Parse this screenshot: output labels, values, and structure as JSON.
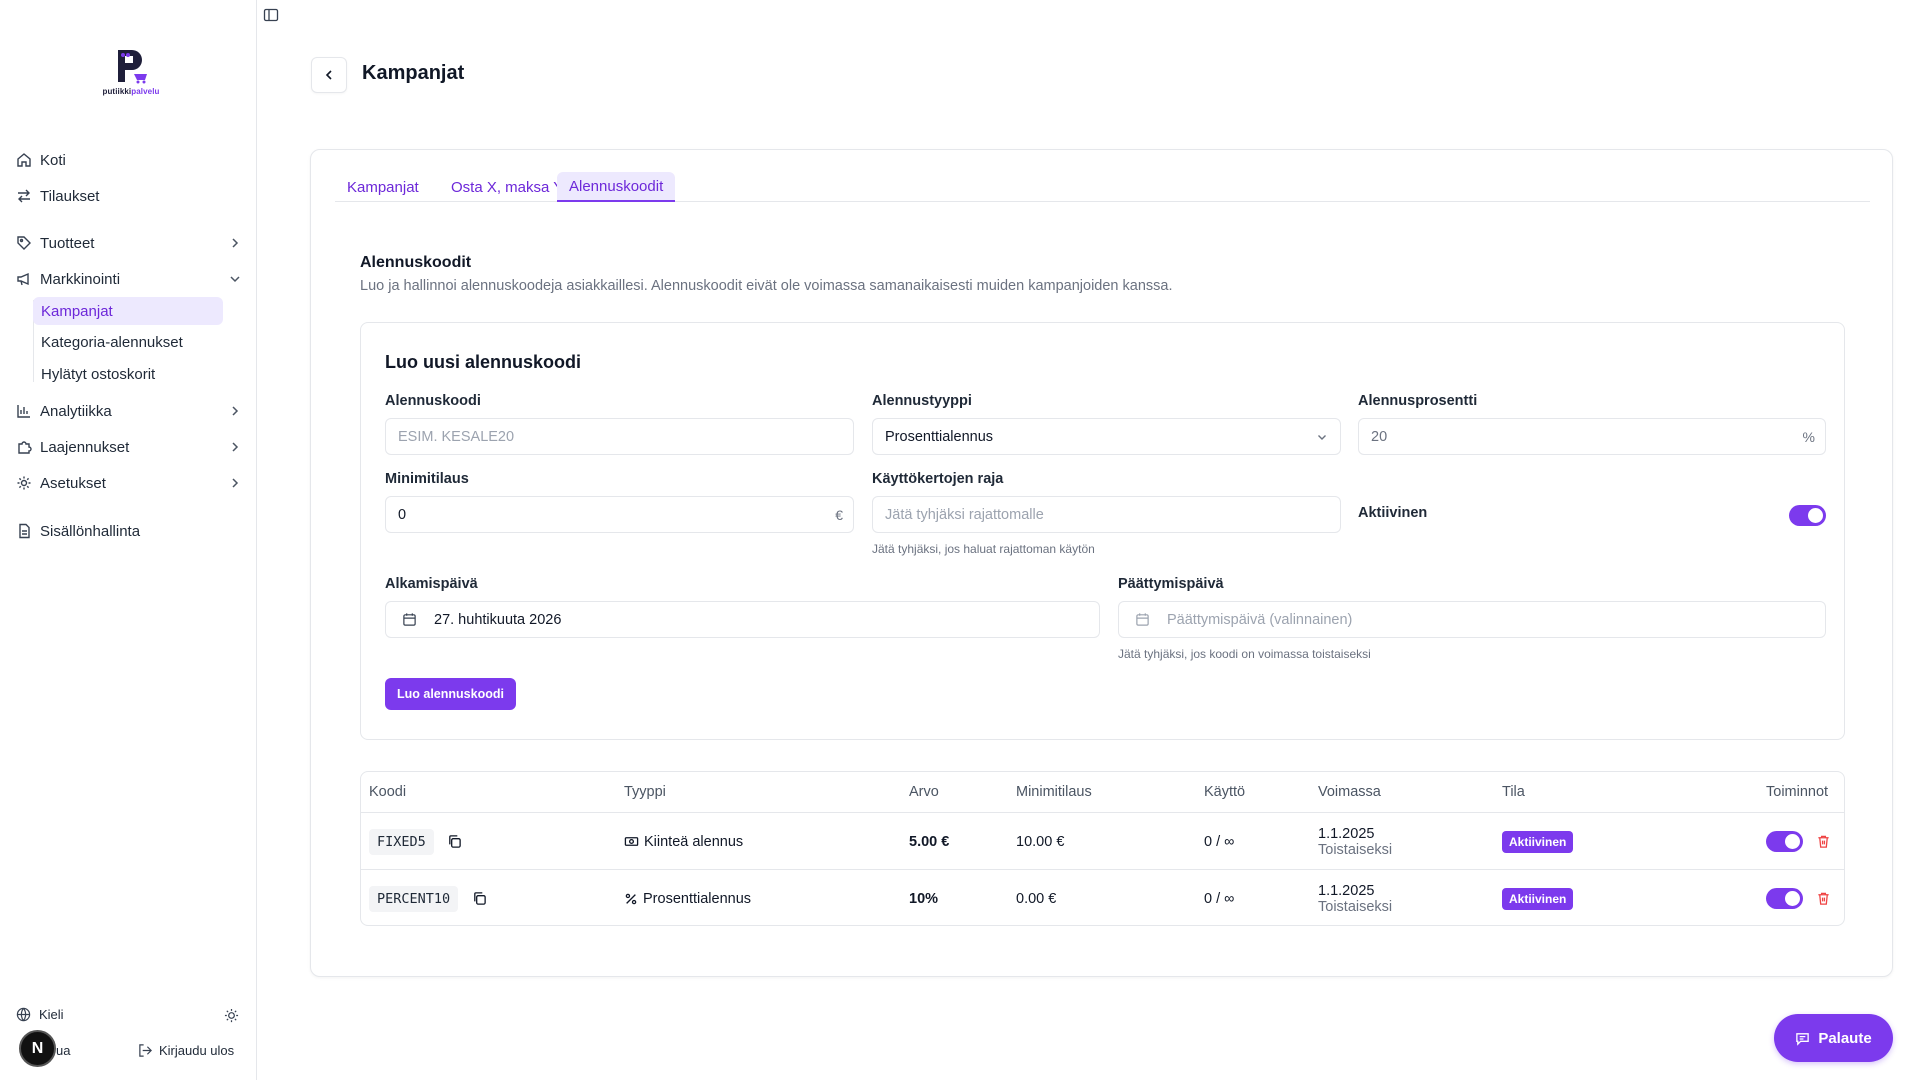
{
  "brand": {
    "logo_text_a": "putiikki",
    "logo_text_b": "palvelu",
    "accent": "#7c3aed",
    "accent_light": "#ede9fe"
  },
  "sidebar": {
    "items": [
      {
        "label": "Koti",
        "icon": "home-icon"
      },
      {
        "label": "Tilaukset",
        "icon": "arrows-icon"
      },
      {
        "label": "Tuotteet",
        "icon": "tag-icon"
      },
      {
        "label": "Markkinointi",
        "icon": "megaphone-icon"
      },
      {
        "label": "Analytiikka",
        "icon": "bar-chart-icon"
      },
      {
        "label": "Laajennukset",
        "icon": "puzzle-icon"
      },
      {
        "label": "Asetukset",
        "icon": "gear-icon"
      },
      {
        "label": "Sisällönhallinta",
        "icon": "document-icon"
      }
    ],
    "sub_items": [
      {
        "label": "Kampanjat",
        "active": true
      },
      {
        "label": "Kategoria-alennukset",
        "active": false
      },
      {
        "label": "Hylätyt ostoskorit",
        "active": false
      }
    ],
    "language_label": "Kieli",
    "user_label": "ua",
    "avatar_letter": "N",
    "logout_label": "Kirjaudu ulos"
  },
  "header": {
    "title": "Kampanjat"
  },
  "tabs": [
    {
      "label": "Kampanjat",
      "active": false
    },
    {
      "label": "Osta X, maksa Y",
      "active": false
    },
    {
      "label": "Alennuskoodit",
      "active": true
    }
  ],
  "section": {
    "title": "Alennuskoodit",
    "description": "Luo ja hallinnoi alennuskoodeja asiakkaillesi. Alennuskoodit eivät ole voimassa samanaikaisesti muiden kampanjoiden kanssa."
  },
  "form": {
    "title": "Luo uusi alennuskoodi",
    "code_label": "Alennuskoodi",
    "code_placeholder": "ESIM. KESALE20",
    "type_label": "Alennustyyppi",
    "type_value": "Prosenttialennus",
    "percent_label": "Alennusprosentti",
    "percent_value": "20",
    "percent_suffix": "%",
    "min_order_label": "Minimitilaus",
    "min_order_value": "0",
    "min_order_suffix": "€",
    "usage_limit_label": "Käyttökertojen raja",
    "usage_limit_placeholder": "Jätä tyhjäksi rajattomalle",
    "usage_limit_help": "Jätä tyhjäksi, jos haluat rajattoman käytön",
    "active_label": "Aktiivinen",
    "active_value": true,
    "start_label": "Alkamispäivä",
    "start_value": "27. huhtikuuta 2026",
    "end_label": "Päättymispäivä",
    "end_placeholder": "Päättymispäivä (valinnainen)",
    "end_help": "Jätä tyhjäksi, jos koodi on voimassa toistaiseksi",
    "submit_label": "Luo alennuskoodi"
  },
  "table": {
    "headers": [
      "Koodi",
      "Tyyppi",
      "Arvo",
      "Minimitilaus",
      "Käyttö",
      "Voimassa",
      "Tila",
      "Toiminnot"
    ],
    "rows": [
      {
        "code": "FIXED5",
        "type": "Kiinteä alennus",
        "type_icon": "banknote-icon",
        "value": "5.00 €",
        "min_order": "10.00 €",
        "usage": "0 / ∞",
        "valid_from": "1.1.2025",
        "valid_to": "Toistaiseksi",
        "status": "Aktiivinen",
        "enabled": true
      },
      {
        "code": "PERCENT10",
        "type": "Prosenttialennus",
        "type_icon": "percent-icon",
        "value": "10%",
        "min_order": "0.00 €",
        "usage": "0 / ∞",
        "valid_from": "1.1.2025",
        "valid_to": "Toistaiseksi",
        "status": "Aktiivinen",
        "enabled": true
      }
    ]
  },
  "feedback": {
    "label": "Palaute"
  }
}
